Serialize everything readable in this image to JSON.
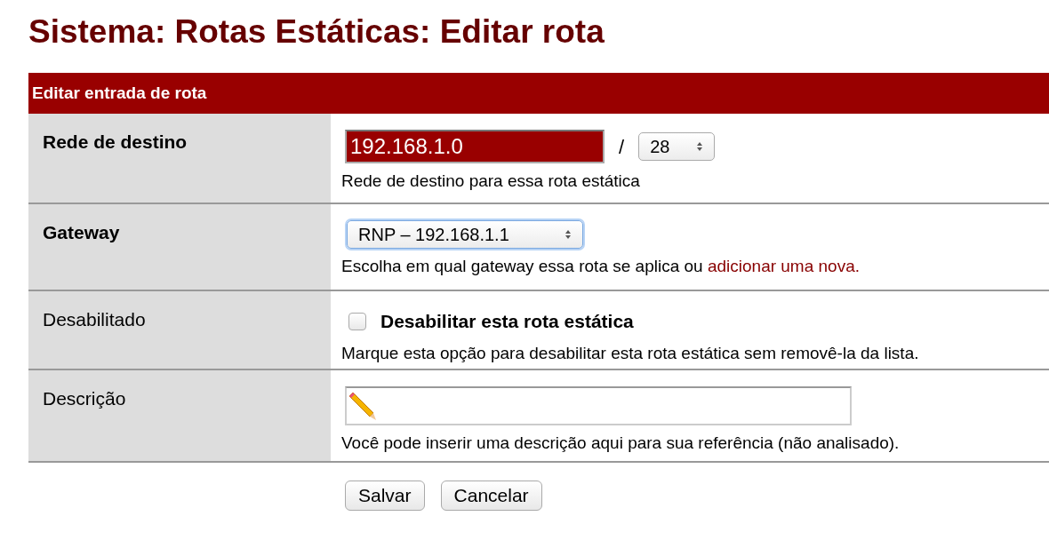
{
  "title": "Sistema: Rotas Estáticas: Editar rota",
  "section": {
    "title": "Editar entrada de rota"
  },
  "rows": [
    {
      "kind": "network",
      "label": "Rede de destino",
      "required": true,
      "value": "192.168.1.0",
      "separator": "/",
      "mask": "28",
      "help": "Rede de destino para essa rota estática"
    },
    {
      "kind": "select",
      "label": "Gateway",
      "required": true,
      "value": "RNP – 192.168.1.1",
      "help": "Escolha em qual gateway essa rota se aplica ou",
      "link": "adicionar uma nova."
    },
    {
      "kind": "checkbox",
      "label": "Desabilitado",
      "required": false,
      "checked": false,
      "caption": "Desabilitar esta rota estática",
      "help": "Marque esta opção para desabilitar esta rota estática sem removê-la da lista."
    },
    {
      "kind": "text",
      "label": "Descrição",
      "required": false,
      "help": "Você pode inserir uma descrição aqui para sua referência (não analisado)."
    }
  ],
  "buttons": [
    "Salvar",
    "Cancelar"
  ]
}
